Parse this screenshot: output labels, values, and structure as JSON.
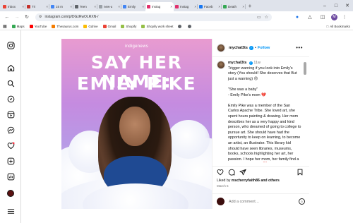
{
  "browser": {
    "tabs": [
      {
        "label": "Inbox",
        "color": "#ea4335",
        "active": false
      },
      {
        "label": "Tri",
        "color": "#c4302b",
        "active": false
      },
      {
        "label": "15 m",
        "color": "#4285f4",
        "active": false
      },
      {
        "label": "Teen",
        "color": "#5f6368",
        "active": false
      },
      {
        "label": "new-u",
        "color": "#9aa0a6",
        "active": false
      },
      {
        "label": "Emily",
        "color": "#4285f4",
        "active": false
      },
      {
        "label": "Instag",
        "color": "#e1306c",
        "active": true
      },
      {
        "label": "Instag",
        "color": "#e1306c",
        "active": false
      },
      {
        "label": "Faceb",
        "color": "#1877f2",
        "active": false
      },
      {
        "label": "Death",
        "color": "#34a853",
        "active": false
      }
    ],
    "new_tab": "+",
    "url": "instagram.com/p/DGzRwOLRXN-/",
    "bookmarks": [
      {
        "label": "Maps",
        "color": "#34a853"
      },
      {
        "label": "YouTube",
        "color": "#ff0000"
      },
      {
        "label": "Thesaurus.com",
        "color": "#f57c00"
      },
      {
        "label": "Gdrive",
        "color": "#fbbc04"
      },
      {
        "label": "Gmail",
        "color": "#ea4335"
      },
      {
        "label": "Shopify",
        "color": "#95bf47"
      },
      {
        "label": "Shopify work sheet",
        "color": "#95bf47"
      }
    ],
    "all_bookmarks": "All Bookmarks",
    "profile_initial": "M"
  },
  "post": {
    "image": {
      "brand": "indigenews",
      "headline_line1": "SAY HER NAME:",
      "headline_line2": "EMILY PIKE"
    },
    "author": "mychal3ts",
    "follow_label": "Follow",
    "more_label": "•••",
    "caption": {
      "username": "mychal3ts",
      "time": "11w",
      "paragraphs": [
        "Trigger warning if you look into Emily's story (You should! She deserves that But just a warning) 😣",
        "\"She was a baby\"\n- Emily Pike's mom 💔",
        "Emily Pike was a member of the San Carlos Apache Tribe. She loved art, she spent hours painting & drawing. Her mom describes her as a very happy and kind person, who dreamed of going to college to pursue art. She should have had the opportunity to keep on learning, to become an artist, an illustrator. This library kid should have seen libraries, museums, books, schools highlighting her art, her passion. I hope her mom, her family find a way to share her art 💔"
      ]
    },
    "likes_prefix": "Liked by",
    "likes_user": "mscherryfaith86",
    "likes_suffix": "and others",
    "date": "March 5",
    "comment_placeholder": "Add a comment…"
  }
}
